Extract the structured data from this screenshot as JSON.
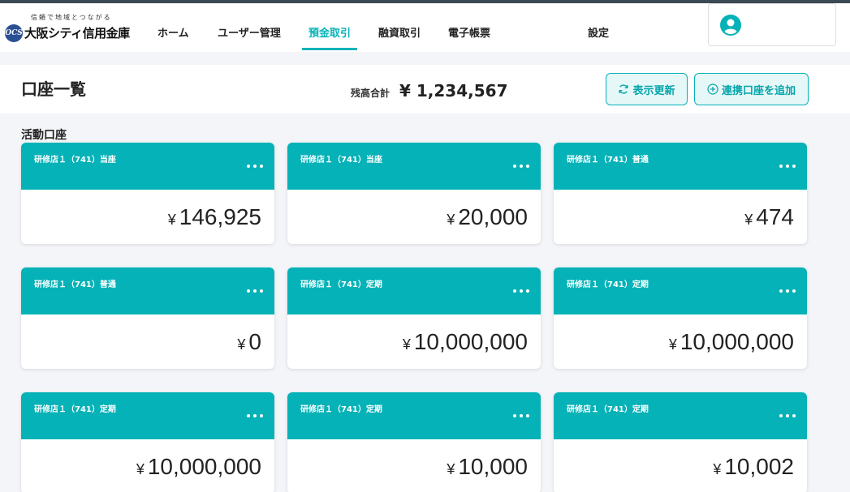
{
  "header": {
    "logo_tagline": "信頼で地域とつながる",
    "logo_mark": "OCS",
    "logo_name": "大阪シティ信用金庫",
    "nav": [
      {
        "label": "ホーム"
      },
      {
        "label": "ユーザー管理"
      },
      {
        "label": "預金取引"
      },
      {
        "label": "融資取引"
      },
      {
        "label": "電子帳票"
      },
      {
        "label": "設定"
      }
    ],
    "active_nav": "預金取引",
    "user_icon": "user-avatar-icon"
  },
  "title_bar": {
    "title": "口座一覧",
    "total_label": "残高合計",
    "total_value": "¥ 1,234,567",
    "refresh_label": "表示更新",
    "add_label": "連携口座を追加"
  },
  "section_title": "活動口座",
  "accounts": [
    {
      "label": "研修店１（741）当座",
      "yen": "¥",
      "amount": "146,925"
    },
    {
      "label": "研修店１（741）当座",
      "yen": "¥",
      "amount": "20,000"
    },
    {
      "label": "研修店１（741）普通",
      "yen": "¥",
      "amount": "474"
    },
    {
      "label": "研修店１（741）普通",
      "yen": "¥",
      "amount": "0"
    },
    {
      "label": "研修店１（741）定期",
      "yen": "¥",
      "amount": "10,000,000"
    },
    {
      "label": "研修店１（741）定期",
      "yen": "¥",
      "amount": "10,000,000"
    },
    {
      "label": "研修店１（741）定期",
      "yen": "¥",
      "amount": "10,000,000"
    },
    {
      "label": "研修店１（741）定期",
      "yen": "¥",
      "amount": "10,000"
    },
    {
      "label": "研修店１（741）定期",
      "yen": "¥",
      "amount": "10,002"
    }
  ],
  "colors": {
    "accent": "#05b2b7",
    "brand_logo": "#2a4f93",
    "background": "#f4f5f8"
  }
}
